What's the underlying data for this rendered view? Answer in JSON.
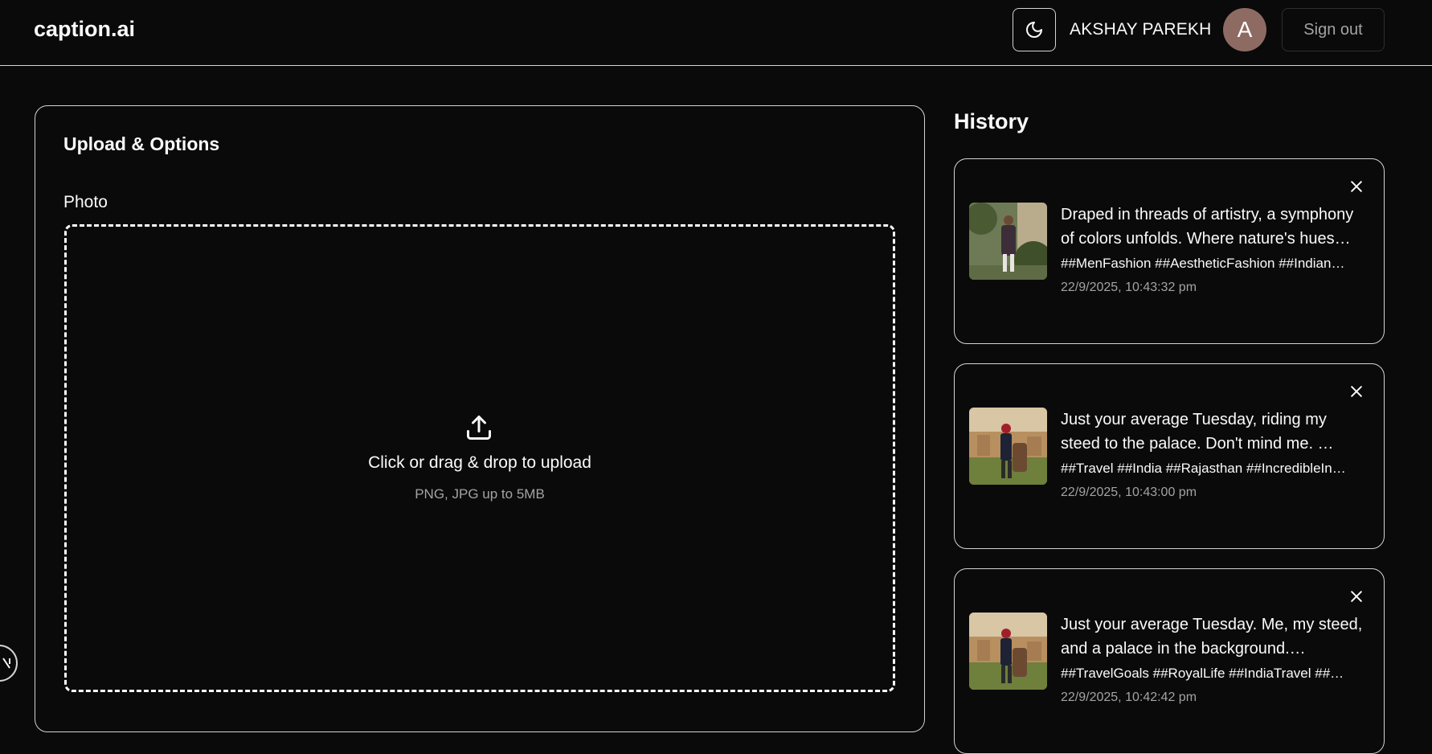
{
  "header": {
    "logo": "caption.ai",
    "theme_icon": "moon-icon",
    "user_name": "AKSHAY PAREKH",
    "avatar_initial": "A",
    "sign_out_label": "Sign out"
  },
  "upload": {
    "title": "Upload & Options",
    "photo_label": "Photo",
    "drop_text": "Click or drag & drop to upload",
    "drop_hint": "PNG, JPG up to 5MB",
    "icon": "upload-icon"
  },
  "history": {
    "title": "History",
    "items": [
      {
        "caption": "Draped in threads of artistry, a symphony of colors unfolds. Where nature's hues…",
        "tags": "##MenFashion ##AestheticFashion ##Indian…",
        "time": "22/9/2025, 10:43:32 pm"
      },
      {
        "caption": "Just your average Tuesday, riding my steed to the palace. Don't mind me. …",
        "tags": "##Travel ##India ##Rajasthan ##IncredibleIn…",
        "time": "22/9/2025, 10:43:00 pm"
      },
      {
        "caption": "Just your average Tuesday. Me, my steed, and a palace in the background.…",
        "tags": "##TravelGoals ##RoyalLife ##IndiaTravel ##…",
        "time": "22/9/2025, 10:42:42 pm"
      }
    ]
  },
  "colors": {
    "background": "#0a0a0a",
    "border": "#d4d4d4",
    "muted_text": "#a3a3a3",
    "avatar": "#8d6b63"
  }
}
